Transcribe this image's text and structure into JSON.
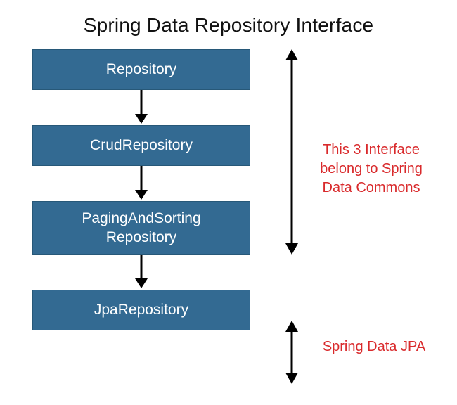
{
  "title": "Spring Data Repository Interface",
  "boxes": {
    "repository": "Repository",
    "crud": "CrudRepository",
    "paging": "PagingAndSorting\nRepository",
    "jpa": "JpaRepository"
  },
  "annotations": {
    "commons": "This 3 Interface\nbelong to Spring\nData Commons",
    "jpa": "Spring Data JPA"
  },
  "colors": {
    "box_bg": "#336a92",
    "box_text": "#ffffff",
    "annotation": "#d92a2c",
    "title": "#111111"
  }
}
